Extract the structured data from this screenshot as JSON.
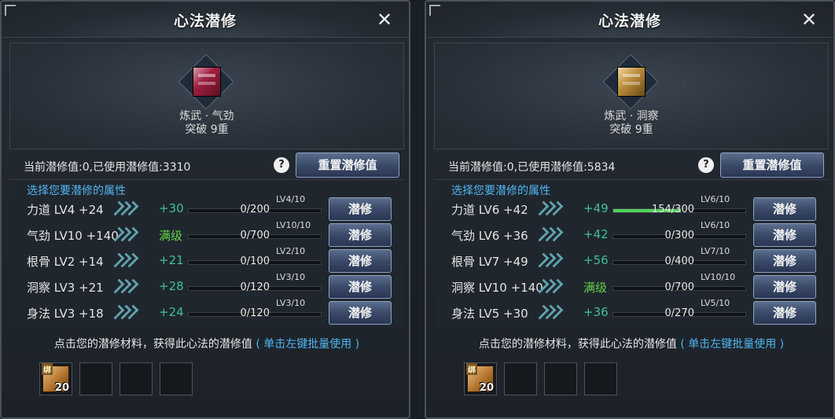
{
  "panels": [
    {
      "title": "心法潜修",
      "skill_name": "炼武 · 气劲",
      "skill_break": "突破 9重",
      "icon": "red-book-icon",
      "status": "当前潜修值:0,已使用潜修值:3310",
      "help_label": "?",
      "reset_button": "重置潜修值",
      "select_hint": "选择您要潜修的属性",
      "rows": [
        {
          "attr": "力道 LV4 +24",
          "bonus": "+30",
          "max": false,
          "progress_text": "0/200",
          "progress": 0,
          "lv": "LV4/10",
          "button": "潜修"
        },
        {
          "attr": "气劲 LV10 +140",
          "bonus": "满级",
          "max": true,
          "progress_text": "0/700",
          "progress": 0,
          "lv": "LV10/10",
          "button": "潜修"
        },
        {
          "attr": "根骨 LV2 +14",
          "bonus": "+21",
          "max": false,
          "progress_text": "0/100",
          "progress": 0,
          "lv": "LV2/10",
          "button": "潜修"
        },
        {
          "attr": "洞察 LV3 +21",
          "bonus": "+28",
          "max": false,
          "progress_text": "0/120",
          "progress": 0,
          "lv": "LV3/10",
          "button": "潜修"
        },
        {
          "attr": "身法 LV3 +18",
          "bonus": "+24",
          "max": false,
          "progress_text": "0/120",
          "progress": 0,
          "lv": "LV3/10",
          "button": "潜修"
        }
      ],
      "bottom_text": "点击您的潜修材料，获得此心法的潜修值",
      "bottom_link": "( 单击左键批量使用 )",
      "slots": [
        {
          "filled": true,
          "badge": "绑",
          "count": "20",
          "icon": "scroll-icon"
        },
        {
          "filled": false
        },
        {
          "filled": false
        },
        {
          "filled": false
        }
      ],
      "close_icon": "close-icon"
    },
    {
      "title": "心法潜修",
      "skill_name": "炼武 · 洞察",
      "skill_break": "突破 9重",
      "icon": "gold-book-icon",
      "status": "当前潜修值:0,已使用潜修值:5834",
      "help_label": "?",
      "reset_button": "重置潜修值",
      "select_hint": "选择您要潜修的属性",
      "rows": [
        {
          "attr": "力道 LV6 +42",
          "bonus": "+49",
          "max": false,
          "progress_text": "154/300",
          "progress": 0.513,
          "lv": "LV6/10",
          "button": "潜修"
        },
        {
          "attr": "气劲 LV6 +36",
          "bonus": "+42",
          "max": false,
          "progress_text": "0/300",
          "progress": 0,
          "lv": "LV6/10",
          "button": "潜修"
        },
        {
          "attr": "根骨 LV7 +49",
          "bonus": "+56",
          "max": false,
          "progress_text": "0/400",
          "progress": 0,
          "lv": "LV7/10",
          "button": "潜修"
        },
        {
          "attr": "洞察 LV10 +140",
          "bonus": "满级",
          "max": true,
          "progress_text": "0/700",
          "progress": 0,
          "lv": "LV10/10",
          "button": "潜修"
        },
        {
          "attr": "身法 LV5 +30",
          "bonus": "+36",
          "max": false,
          "progress_text": "0/270",
          "progress": 0,
          "lv": "LV5/10",
          "button": "潜修"
        }
      ],
      "bottom_text": "点击您的潜修材料，获得此心法的潜修值",
      "bottom_link": "( 单击左键批量使用 )",
      "slots": [
        {
          "filled": true,
          "badge": "绑",
          "count": "20",
          "icon": "scroll-icon"
        },
        {
          "filled": false
        },
        {
          "filled": false
        },
        {
          "filled": false
        }
      ],
      "close_icon": "close-icon"
    }
  ],
  "colors": {
    "bonus": "#3fbf9f",
    "max_level": "#62d24a",
    "hint": "#4fb6f0",
    "progress_fill": "#4fd45a"
  }
}
